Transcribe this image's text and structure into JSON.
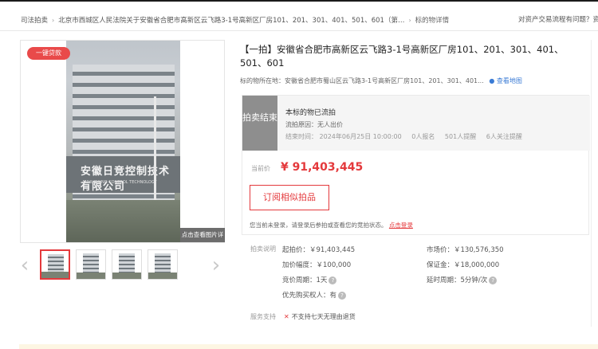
{
  "breadcrumb": {
    "items": [
      "司法拍卖",
      "北京市西城区人民法院关于安徽省合肥市高新区云飞路3-1号高新区厂房101、201、301、401、501、601（第…",
      "标的物详情"
    ],
    "help_link": "对资产交易流程有问题？资产交"
  },
  "gallery": {
    "badge": "一键贷款",
    "view_detail": "点击查看图片详情",
    "sign_text": "安徽日竞控制技术有限公司",
    "sign_sub": "ANHUIRIJING CONTROL TECHNOLOGY"
  },
  "item": {
    "title": "【一拍】安徽省合肥市高新区云飞路3-1号高新区厂房101、201、301、401、501、601",
    "location_label": "标的物所在地：",
    "location_value": "安徽省合肥市蜀山区云飞路3-1号高新区厂房101、201、301、401...",
    "map_link": "查看地图"
  },
  "status": {
    "tag": "拍卖结束",
    "title": "本标的物已流拍",
    "reason": "流拍原因：无人出价",
    "end_time": "结束时间： 2024年06月25日 10:00:00",
    "applicants": "0人报名",
    "reminders": "501人提醒",
    "followers": "6人关注提醒"
  },
  "price": {
    "label": "当前价",
    "value": "¥ 91,403,445"
  },
  "subscribe_button": "订阅相似拍品",
  "login_tip": {
    "text": "您当前未登录，请登录后参拍或查看您的竞拍状态。",
    "link": "点击登录"
  },
  "auction_info": {
    "label": "拍卖说明",
    "start_price": "起拍价：￥91,403,445",
    "market_price": "市场价：￥130,576,350",
    "increment": "加价幅度：￥100,000",
    "deposit": "保证金：￥18,000,000",
    "bid_period": "竞价周期：1天",
    "delay_period": "延时周期：5分钟/次",
    "priority": "优先购买权人：有"
  },
  "service": {
    "label": "服务支持",
    "item": "不支持七天无理由退货"
  }
}
